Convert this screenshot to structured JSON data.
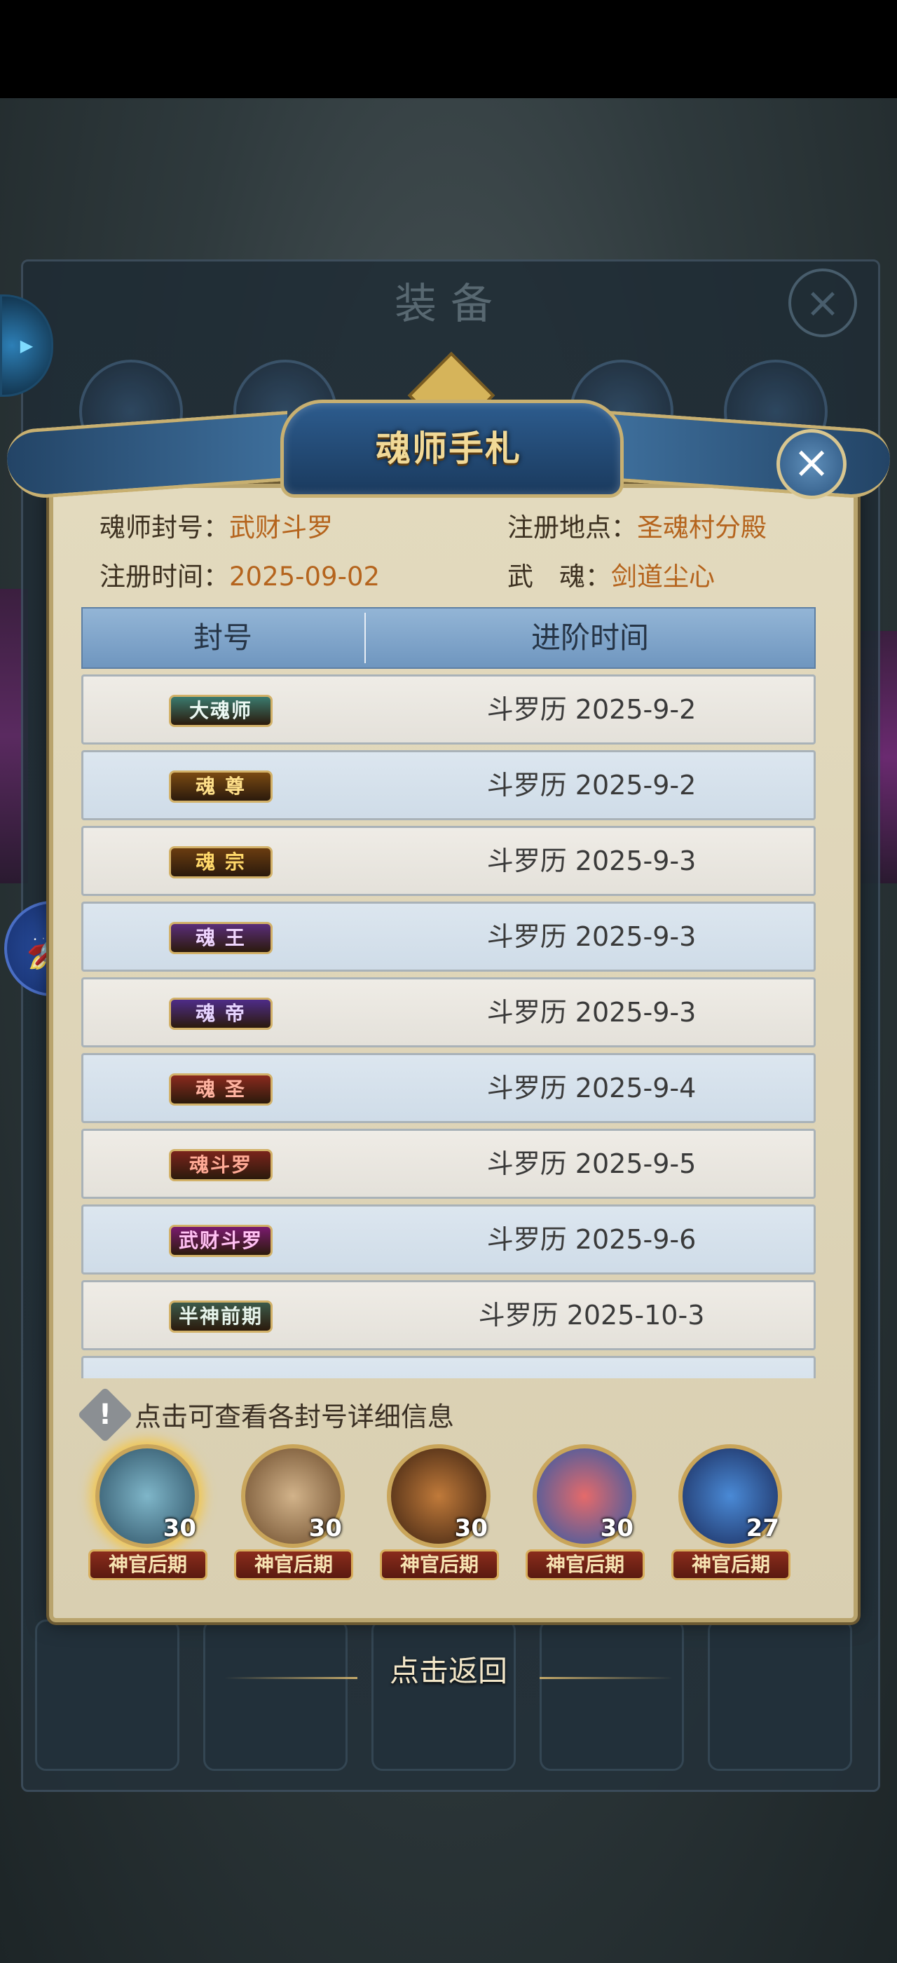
{
  "background": {
    "panel_title": "装备"
  },
  "dialog": {
    "title": "魂师手札",
    "close_label": "×",
    "info": {
      "title_label": "魂师封号：",
      "title_value": "武财斗罗",
      "location_label": "注册地点：",
      "location_value": "圣魂村分殿",
      "date_label": "注册时间：",
      "date_value": "2025-09-02",
      "soul_label": "武　魂：",
      "soul_value": "剑道尘心"
    },
    "table": {
      "headers": [
        "封号",
        "进阶时间"
      ],
      "rows": [
        {
          "badge": "大魂师",
          "date": "斗罗历 2025-9-2",
          "color": "#3a7a6e",
          "text_color": "#eaf7f2"
        },
        {
          "badge": "魂 尊",
          "date": "斗罗历 2025-9-2",
          "color": "#7a4a12",
          "text_color": "#ffe08a"
        },
        {
          "badge": "魂 宗",
          "date": "斗罗历 2025-9-3",
          "color": "#6a3c10",
          "text_color": "#ffd86a"
        },
        {
          "badge": "魂 王",
          "date": "斗罗历 2025-9-3",
          "color": "#5a2d7a",
          "text_color": "#f0d6ff"
        },
        {
          "badge": "魂 帝",
          "date": "斗罗历 2025-9-3",
          "color": "#4e2c88",
          "text_color": "#e6d4ff"
        },
        {
          "badge": "魂 圣",
          "date": "斗罗历 2025-9-4",
          "color": "#8a2a1e",
          "text_color": "#ffb3a0"
        },
        {
          "badge": "魂斗罗",
          "date": "斗罗历 2025-9-5",
          "color": "#7a241c",
          "text_color": "#ffaa95"
        },
        {
          "badge": "武财斗罗",
          "date": "斗罗历 2025-9-6",
          "color": "#7a1a6e",
          "text_color": "#ffc0f2"
        },
        {
          "badge": "半神前期",
          "date": "斗罗历 2025-10-3",
          "color": "#3c5a4a",
          "text_color": "#e6f3ea"
        }
      ]
    },
    "hint": "点击可查看各封号详细信息",
    "characters": [
      {
        "level": "30",
        "tag": "神官后期"
      },
      {
        "level": "30",
        "tag": "神官后期"
      },
      {
        "level": "30",
        "tag": "神官后期"
      },
      {
        "level": "30",
        "tag": "神官后期"
      },
      {
        "level": "27",
        "tag": "神官后期"
      }
    ],
    "return_label": "点击返回"
  }
}
